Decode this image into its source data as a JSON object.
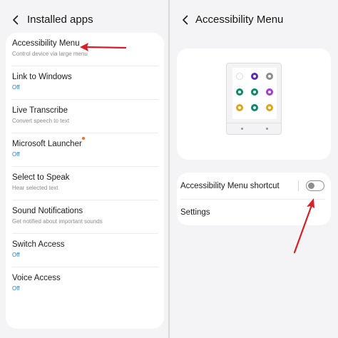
{
  "left": {
    "title": "Installed apps",
    "items": [
      {
        "title": "Accessibility Menu",
        "sub": "Control device via large menu",
        "sub_style": "gray"
      },
      {
        "title": "Link to Windows",
        "sub": "Off",
        "sub_style": "blue"
      },
      {
        "title": "Live Transcribe",
        "sub": "Convert speech to text",
        "sub_style": "gray"
      },
      {
        "title": "Microsoft Launcher",
        "sub": "Off",
        "sub_style": "blue",
        "badge": true
      },
      {
        "title": "Select to Speak",
        "sub": "Hear selected text",
        "sub_style": "gray"
      },
      {
        "title": "Sound Notifications",
        "sub": "Get notified about important sounds",
        "sub_style": "gray"
      },
      {
        "title": "Switch Access",
        "sub": "Off",
        "sub_style": "blue"
      },
      {
        "title": "Voice Access",
        "sub": "Off",
        "sub_style": "blue"
      }
    ]
  },
  "right": {
    "title": "Accessibility Menu",
    "shortcut_label": "Accessibility Menu shortcut",
    "shortcut_enabled": false,
    "settings_label": "Settings"
  },
  "preview_icons": [
    {
      "name": "assistant-icon",
      "color": "#ffffff",
      "border": "#dadada"
    },
    {
      "name": "accessibility-icon",
      "color": "#5b2ab8"
    },
    {
      "name": "power-icon",
      "color": "#8d8d8d"
    },
    {
      "name": "settings-icon",
      "color": "#0b8a6a"
    },
    {
      "name": "volume-icon",
      "color": "#0b8a6a"
    },
    {
      "name": "screenshot-icon",
      "color": "#a63bd0"
    },
    {
      "name": "brightness-icon",
      "color": "#e0a516"
    },
    {
      "name": "lock-icon",
      "color": "#0b8a6a"
    },
    {
      "name": "notifications-icon",
      "color": "#e0a516"
    }
  ],
  "colors": {
    "annotation_arrow": "#d81f26",
    "off_text": "#2a7ccf",
    "badge": "#f26b2a"
  }
}
